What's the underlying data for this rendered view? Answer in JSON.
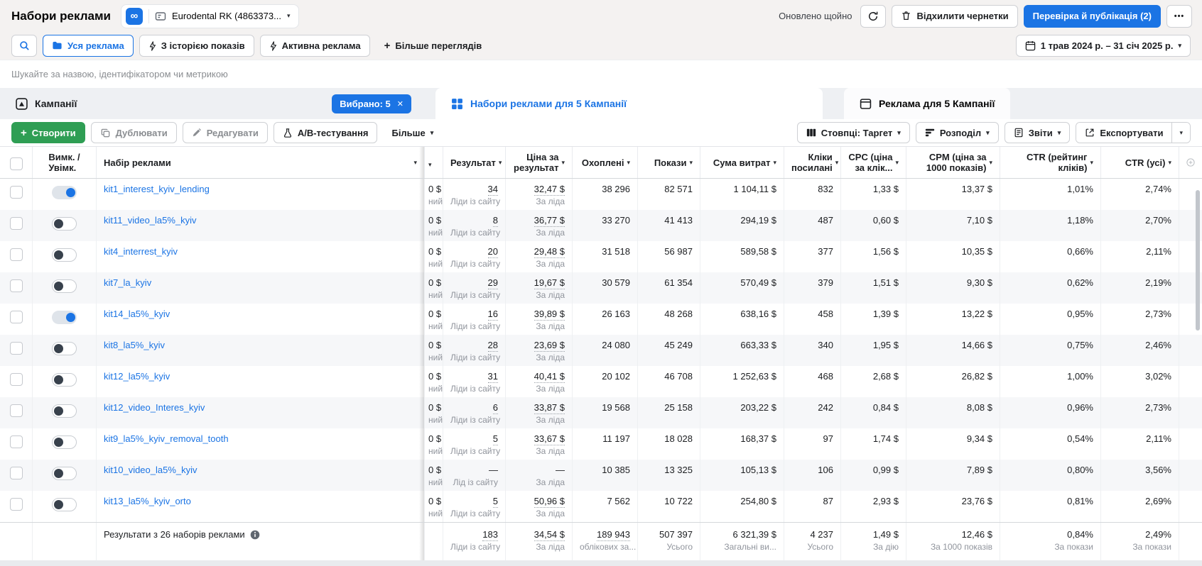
{
  "colors": {
    "accent_blue": "#1b74e4",
    "create_green": "#2f9e54",
    "toggle_off_knob": "#38414c",
    "link_blue": "#1b74e4"
  },
  "header": {
    "title": "Набори реклами",
    "account_name": "Eurodental RK (4863373...",
    "updated": "Оновлено щойно",
    "discard_label": "Відхилити чернетки",
    "publish_label": "Перевірка й публікація (2)"
  },
  "filterbar": {
    "all_ads": "Уся реклама",
    "had_delivery": "З історією показів",
    "active_ads": "Активна реклама",
    "more_views": "Більше переглядів",
    "date_range": "1 трав 2024 р. – 31 січ 2025 р."
  },
  "search": {
    "placeholder": "Шукайте за назвою, ідентифікатором чи метрикою"
  },
  "tabs": {
    "campaigns": "Кампанії",
    "selected_badge": "Вибрано: 5",
    "badge_close": "✕",
    "adsets": "Набори реклами для 5 Кампанії",
    "ads": "Реклама для 5 Кампанії"
  },
  "toolbar": {
    "create": "Створити",
    "duplicate": "Дублювати",
    "edit": "Редагувати",
    "ab_test": "А/В-тестування",
    "more": "Більше",
    "columns": "Стовпці: Таргет",
    "breakdown": "Розподіл",
    "reports": "Звіти",
    "export": "Експортувати"
  },
  "table": {
    "col_toggle": "Вимк. / Увімк.",
    "col_name": "Набір реклами",
    "budget_sliver": {
      "top": "0 $",
      "bottom": "ний"
    },
    "columns": [
      {
        "id": "result",
        "label": "Результат"
      },
      {
        "id": "cost",
        "label": "Ціна за результат"
      },
      {
        "id": "reach",
        "label": "Охоплені"
      },
      {
        "id": "impressions",
        "label": "Покази"
      },
      {
        "id": "spend",
        "label": "Сума витрат"
      },
      {
        "id": "clicks",
        "label": "Кліки посилані"
      },
      {
        "id": "cpc",
        "label": "CPC (ціна за клік..."
      },
      {
        "id": "cpm",
        "label": "CPM (ціна за 1000 показів)"
      },
      {
        "id": "ctr_link",
        "label": "CTR (рейтинг кліків)"
      },
      {
        "id": "ctr_all",
        "label": "CTR (усі)"
      }
    ],
    "rows": [
      {
        "name": "kit1_interest_kyiv_lending",
        "toggle_on": true,
        "result": "34",
        "result_sub": "Ліди із сайту",
        "cost": "32,47 $",
        "cost_sub": "За ліда",
        "reach": "38 296",
        "impressions": "82 571",
        "spend": "1 104,11 $",
        "clicks": "832",
        "cpc": "1,33 $",
        "cpm": "13,37 $",
        "ctr_link": "1,01%",
        "ctr_all": "2,74%"
      },
      {
        "name": "kit11_video_la5%_kyiv",
        "toggle_on": false,
        "result": "8",
        "result_sub": "Ліди із сайту",
        "cost": "36,77 $",
        "cost_sub": "За ліда",
        "reach": "33 270",
        "impressions": "41 413",
        "spend": "294,19 $",
        "clicks": "487",
        "cpc": "0,60 $",
        "cpm": "7,10 $",
        "ctr_link": "1,18%",
        "ctr_all": "2,70%"
      },
      {
        "name": "kit4_interrest_kyiv",
        "toggle_on": false,
        "result": "20",
        "result_sub": "Ліди із сайту",
        "cost": "29,48 $",
        "cost_sub": "За ліда",
        "reach": "31 518",
        "impressions": "56 987",
        "spend": "589,58 $",
        "clicks": "377",
        "cpc": "1,56 $",
        "cpm": "10,35 $",
        "ctr_link": "0,66%",
        "ctr_all": "2,11%"
      },
      {
        "name": "kit7_la_kyiv",
        "toggle_on": false,
        "result": "29",
        "result_sub": "Ліди із сайту",
        "cost": "19,67 $",
        "cost_sub": "За ліда",
        "reach": "30 579",
        "impressions": "61 354",
        "spend": "570,49 $",
        "clicks": "379",
        "cpc": "1,51 $",
        "cpm": "9,30 $",
        "ctr_link": "0,62%",
        "ctr_all": "2,19%"
      },
      {
        "name": "kit14_la5%_kyiv",
        "toggle_on": true,
        "result": "16",
        "result_sub": "Ліди із сайту",
        "cost": "39,89 $",
        "cost_sub": "За ліда",
        "reach": "26 163",
        "impressions": "48 268",
        "spend": "638,16 $",
        "clicks": "458",
        "cpc": "1,39 $",
        "cpm": "13,22 $",
        "ctr_link": "0,95%",
        "ctr_all": "2,73%"
      },
      {
        "name": "kit8_la5%_kyiv",
        "toggle_on": false,
        "result": "28",
        "result_sub": "Ліди із сайту",
        "cost": "23,69 $",
        "cost_sub": "За ліда",
        "reach": "24 080",
        "impressions": "45 249",
        "spend": "663,33 $",
        "clicks": "340",
        "cpc": "1,95 $",
        "cpm": "14,66 $",
        "ctr_link": "0,75%",
        "ctr_all": "2,46%"
      },
      {
        "name": "kit12_la5%_kyiv",
        "toggle_on": false,
        "result": "31",
        "result_sub": "Ліди із сайту",
        "cost": "40,41 $",
        "cost_sub": "За ліда",
        "reach": "20 102",
        "impressions": "46 708",
        "spend": "1 252,63 $",
        "clicks": "468",
        "cpc": "2,68 $",
        "cpm": "26,82 $",
        "ctr_link": "1,00%",
        "ctr_all": "3,02%"
      },
      {
        "name": "kit12_video_Interes_kyiv",
        "toggle_on": false,
        "result": "6",
        "result_sub": "Ліди із сайту",
        "cost": "33,87 $",
        "cost_sub": "За ліда",
        "reach": "19 568",
        "impressions": "25 158",
        "spend": "203,22 $",
        "clicks": "242",
        "cpc": "0,84 $",
        "cpm": "8,08 $",
        "ctr_link": "0,96%",
        "ctr_all": "2,73%"
      },
      {
        "name": "kit9_la5%_kyiv_removal_tooth",
        "toggle_on": false,
        "result": "5",
        "result_sub": "Ліди із сайту",
        "cost": "33,67 $",
        "cost_sub": "За ліда",
        "reach": "11 197",
        "impressions": "18 028",
        "spend": "168,37 $",
        "clicks": "97",
        "cpc": "1,74 $",
        "cpm": "9,34 $",
        "ctr_link": "0,54%",
        "ctr_all": "2,11%"
      },
      {
        "name": "kit10_video_la5%_kyiv",
        "toggle_on": false,
        "result": "—",
        "result_sub": "Лід із сайту",
        "cost": "—",
        "cost_sub": "За ліда",
        "reach": "10 385",
        "impressions": "13 325",
        "spend": "105,13 $",
        "clicks": "106",
        "cpc": "0,99 $",
        "cpm": "7,89 $",
        "ctr_link": "0,80%",
        "ctr_all": "3,56%"
      },
      {
        "name": "kit13_la5%_kyiv_orto",
        "toggle_on": false,
        "result": "5",
        "result_sub": "Ліди із сайту",
        "cost": "50,96 $",
        "cost_sub": "За ліда",
        "reach": "7 562",
        "impressions": "10 722",
        "spend": "254,80 $",
        "clicks": "87",
        "cpc": "2,93 $",
        "cpm": "23,76 $",
        "ctr_link": "0,81%",
        "ctr_all": "2,69%"
      }
    ],
    "footer": {
      "label": "Результати з 26 наборів реклами",
      "result": "183",
      "result_sub": "Ліди із сайту",
      "cost": "34,54 $",
      "cost_sub": "За ліда",
      "reach": "189 943",
      "reach_sub": "облікових за...",
      "impressions": "507 397",
      "impressions_sub": "Усього",
      "spend": "6 321,39 $",
      "spend_sub": "Загальні ви...",
      "clicks": "4 237",
      "clicks_sub": "Усього",
      "cpc": "1,49 $",
      "cpc_sub": "За дію",
      "cpm": "12,46 $",
      "cpm_sub": "За 1000 показів",
      "ctr_link": "0,84%",
      "ctr_link_sub": "За покази",
      "ctr_all": "2,49%",
      "ctr_all_sub": "За покази"
    }
  }
}
